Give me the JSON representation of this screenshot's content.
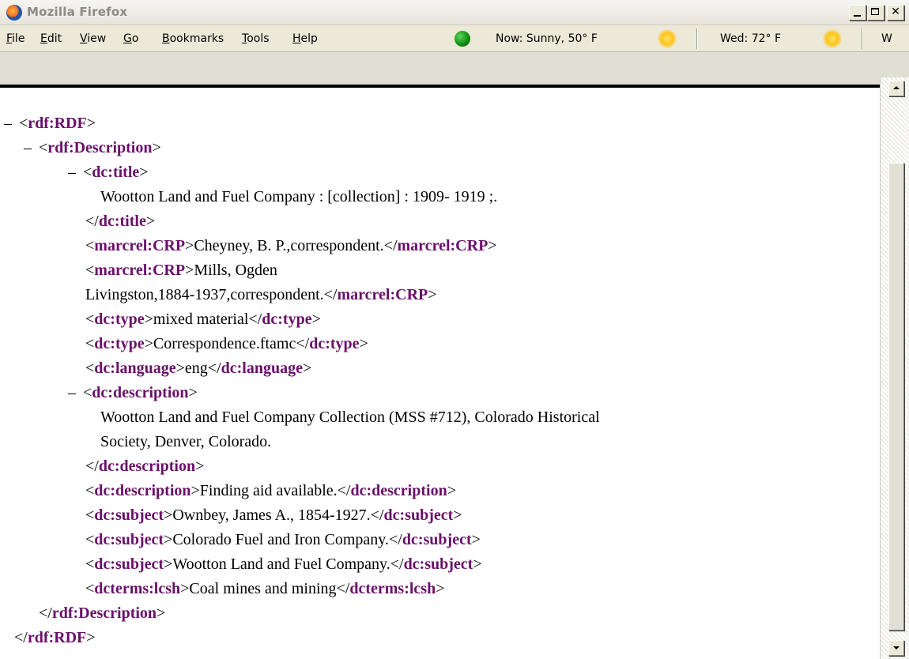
{
  "window": {
    "title": "Mozilla Firefox"
  },
  "menu": {
    "items": [
      {
        "key": "F",
        "rest": "ile"
      },
      {
        "key": "E",
        "rest": "dit"
      },
      {
        "key": "V",
        "rest": "iew"
      },
      {
        "key": "G",
        "rest": "o"
      },
      {
        "key": "B",
        "rest": "ookmarks"
      },
      {
        "key": "T",
        "rest": "ools"
      },
      {
        "key": "H",
        "rest": "elp"
      }
    ]
  },
  "weather": {
    "now": "Now: Sunny, 50° F",
    "forecast": "Wed: 72° F",
    "next": "W"
  },
  "xml": {
    "collapse_glyph": "–",
    "lines": {
      "rdf_open_tag": "rdf:RDF",
      "desc_open_tag": "rdf:Description",
      "title_open_tag": "dc:title",
      "title_text": "Wootton Land and Fuel Company : [collection] : 1909- 1919 ;.",
      "title_close_tag": "dc:title",
      "crp1_tag": "marcrel:CRP",
      "crp1_text": "Cheyney, B. P.,correspondent.",
      "crp2_tag": "marcrel:CRP",
      "crp2_text_a": "Mills, Ogden",
      "crp2_text_b": "Livingston,1884-1937,correspondent.",
      "type1_tag": "dc:type",
      "type1_text": "mixed material",
      "type2_tag": "dc:type",
      "type2_text": "Correspondence.ftamc",
      "lang_tag": "dc:language",
      "lang_text": "eng",
      "desc1_open_tag": "dc:description",
      "desc1_text_a": "Wootton Land and Fuel Company Collection (MSS #712), Colorado Historical",
      "desc1_text_b": "Society, Denver, Colorado.",
      "desc1_close_tag": "dc:description",
      "desc2_tag": "dc:description",
      "desc2_text": "Finding aid available.",
      "subj1_tag": "dc:subject",
      "subj1_text": "Ownbey, James A., 1854-1927.",
      "subj2_tag": "dc:subject",
      "subj2_text": "Colorado Fuel and Iron Company.",
      "subj3_tag": "dc:subject",
      "subj3_text": "Wootton Land and Fuel Company.",
      "lcsh_tag": "dcterms:lcsh",
      "lcsh_text": "Coal mines and mining",
      "desc_close_tag": "rdf:Description",
      "rdf_close_tag": "rdf:RDF"
    }
  }
}
